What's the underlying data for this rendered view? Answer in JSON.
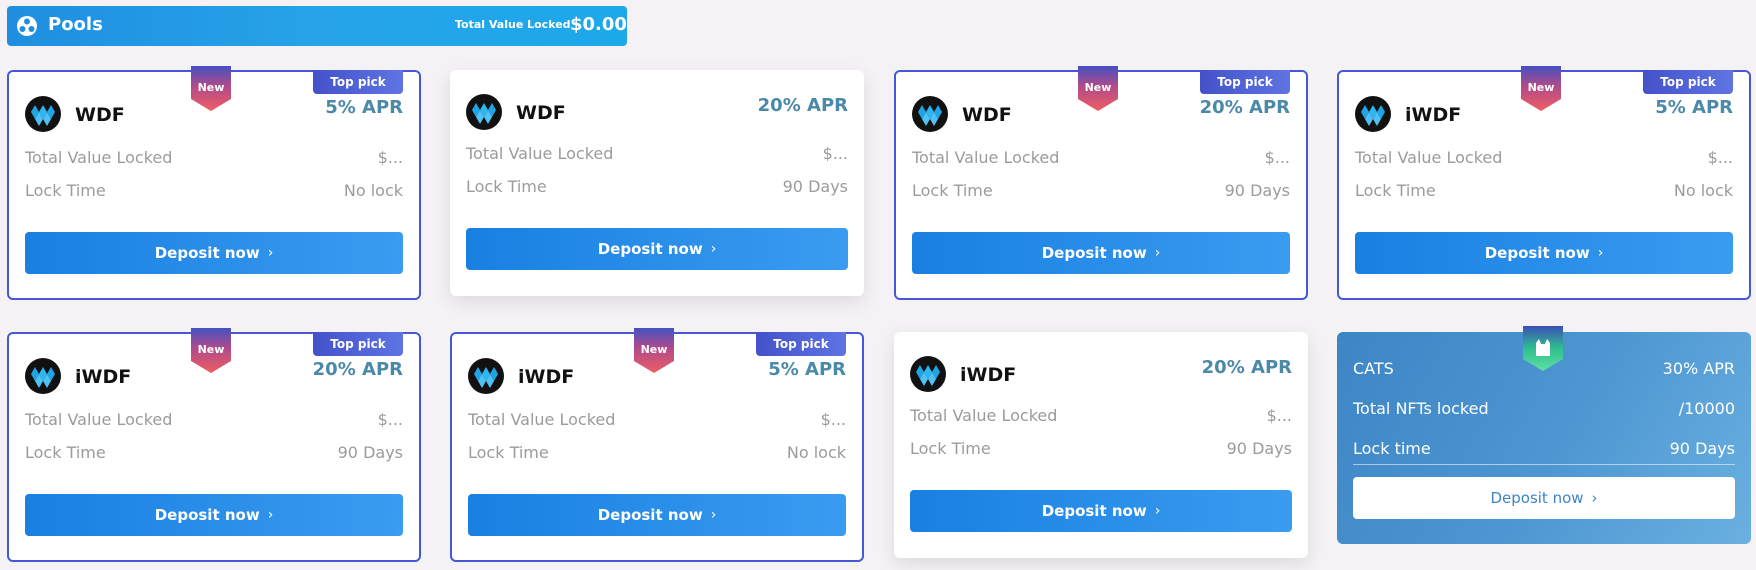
{
  "header": {
    "title": "Pools",
    "tvl_label": "Total Value Locked",
    "tvl_value": "$0.00",
    "logo_icon": "pools-logo-icon"
  },
  "badges": {
    "new": "New",
    "top_pick": "Top pick"
  },
  "labels": {
    "tvl": "Total Value Locked",
    "lock_time": "Lock Time",
    "deposit": "Deposit now",
    "chevron": "›"
  },
  "pools": [
    {
      "token": "WDF",
      "apr": "5% APR",
      "tvl": "$...",
      "lock": "No lock",
      "new": true,
      "top_pick": true
    },
    {
      "token": "WDF",
      "apr": "20% APR",
      "tvl": "$...",
      "lock": "90 Days",
      "new": false,
      "top_pick": false
    },
    {
      "token": "WDF",
      "apr": "20% APR",
      "tvl": "$...",
      "lock": "90 Days",
      "new": true,
      "top_pick": true
    },
    {
      "token": "iWDF",
      "apr": "5% APR",
      "tvl": "$...",
      "lock": "No lock",
      "new": true,
      "top_pick": true
    },
    {
      "token": "iWDF",
      "apr": "20% APR",
      "tvl": "$...",
      "lock": "90 Days",
      "new": true,
      "top_pick": true
    },
    {
      "token": "iWDF",
      "apr": "5% APR",
      "tvl": "$...",
      "lock": "No lock",
      "new": true,
      "top_pick": true
    },
    {
      "token": "iWDF",
      "apr": "20% APR",
      "tvl": "$...",
      "lock": "90 Days",
      "new": false,
      "top_pick": false
    }
  ],
  "nft_pool": {
    "name": "CATS",
    "apr": "30% APR",
    "nfts_label": "Total NFTs locked",
    "nfts_value": "/10000",
    "lock_label": "Lock time",
    "lock_value": "90 Days",
    "deposit": "Deposit now",
    "badge_icon": "cat-icon"
  },
  "colors": {
    "accent_blue": "#1980e2",
    "card_border": "#4458d8",
    "apr_text": "#4a89a8",
    "new_badge": "#e0566a"
  }
}
